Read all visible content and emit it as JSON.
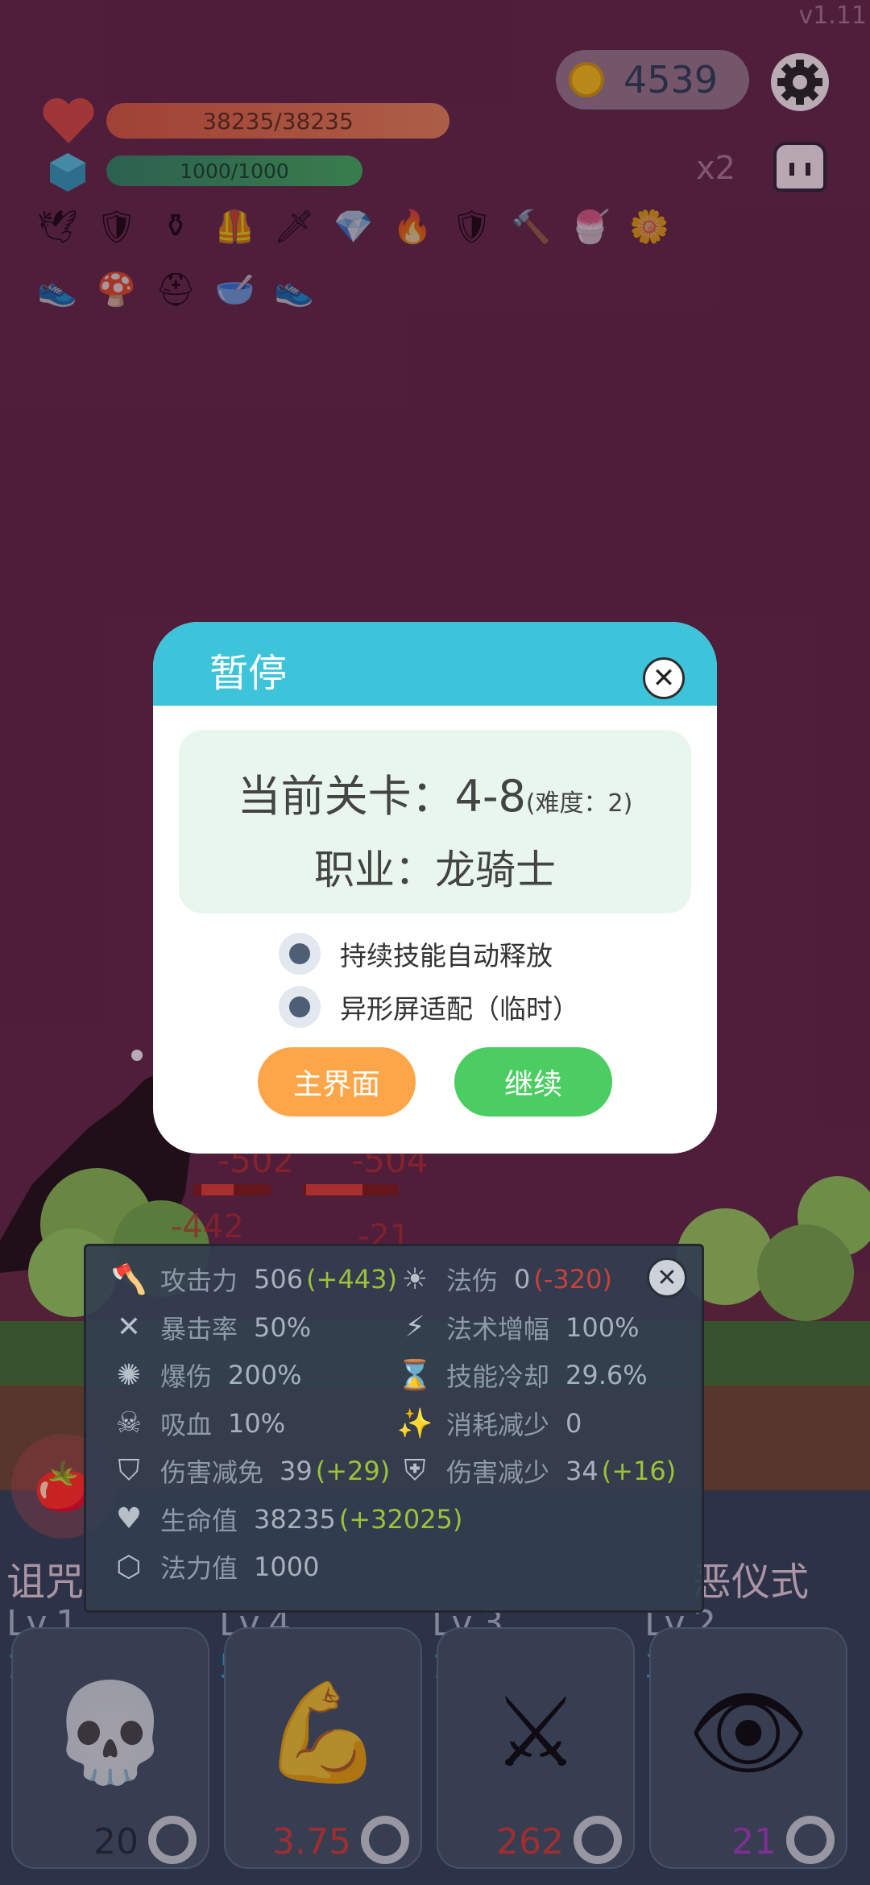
{
  "version": "v1.11",
  "coins": "4539",
  "hud": {
    "hp_text": "38235/38235",
    "hp_fraction": 1.0,
    "mp_text": "1000/1000",
    "mp_fraction": 1.0,
    "speed_multiplier": "x2"
  },
  "inventory": [
    {
      "icon": "bird-icon",
      "glyph": "🕊"
    },
    {
      "icon": "shield-icon",
      "glyph": "🛡"
    },
    {
      "icon": "cauldron-icon",
      "glyph": "⚱"
    },
    {
      "icon": "armor-icon",
      "glyph": "🦺"
    },
    {
      "icon": "sword-icon",
      "glyph": "🗡"
    },
    {
      "icon": "diamond-icon",
      "glyph": "💎"
    },
    {
      "icon": "torch-icon",
      "glyph": "🔥"
    },
    {
      "icon": "shield-icon",
      "glyph": "🛡"
    },
    {
      "icon": "mace-icon",
      "glyph": "🔨"
    },
    {
      "icon": "ice-cream-icon",
      "glyph": "🍧"
    },
    {
      "icon": "flower-icon",
      "glyph": "🌼"
    },
    {
      "icon": "boots-icon",
      "glyph": "👟"
    },
    {
      "icon": "mushroom-icon",
      "glyph": "🍄"
    },
    {
      "icon": "helmet-icon",
      "glyph": "⛑"
    },
    {
      "icon": "mortar-icon",
      "glyph": "🥣"
    },
    {
      "icon": "boots-icon",
      "glyph": "👟"
    }
  ],
  "pause_dialog": {
    "title": "暂停",
    "stage_label": "当前关卡：4-8",
    "difficulty": "(难度：2)",
    "job": "职业：龙骑士",
    "options": [
      {
        "label": "持续技能自动释放",
        "checked": true
      },
      {
        "label": "异形屏适配（临时）",
        "checked": true
      }
    ],
    "main_menu_button": "主界面",
    "continue_button": "继续"
  },
  "floating_damage": [
    "-502",
    "-504",
    "-442",
    "-21"
  ],
  "stats": [
    {
      "icon": "axe-icon",
      "label": "攻击力",
      "value": "506",
      "bonus": "(+443)",
      "bonus_type": "pos"
    },
    {
      "icon": "sun-icon",
      "label": "法伤",
      "value": "0",
      "bonus": "(-320)",
      "bonus_type": "neg"
    },
    {
      "icon": "crit-icon",
      "label": "暴击率",
      "value": "50%"
    },
    {
      "icon": "lightning-icon",
      "label": "法术增幅",
      "value": "100%"
    },
    {
      "icon": "burst-icon",
      "label": "爆伤",
      "value": "200%"
    },
    {
      "icon": "hourglass-icon",
      "label": "技能冷却",
      "value": "29.6%"
    },
    {
      "icon": "vampire-icon",
      "label": "吸血",
      "value": "10%"
    },
    {
      "icon": "wand-icon",
      "label": "消耗减少",
      "value": "0"
    },
    {
      "icon": "shield-icon",
      "label": "伤害减免",
      "value": "39",
      "bonus": "(+29)",
      "bonus_type": "pos"
    },
    {
      "icon": "guard-icon",
      "label": "伤害减少",
      "value": "34",
      "bonus": "(+16)",
      "bonus_type": "pos"
    },
    {
      "icon": "heart-icon",
      "label": "生命值",
      "value": "38235",
      "bonus": "(+32025)",
      "bonus_type": "pos"
    },
    {
      "icon": "hexagon-icon",
      "label": "法力值",
      "value": "1000"
    }
  ],
  "skills": [
    {
      "title": "诅咒",
      "level": "Lv.1",
      "cost": "10",
      "icon": "skull-icon",
      "glyph": "💀",
      "count": "20",
      "count_color": "#1e2a38"
    },
    {
      "title": "",
      "level": "Lv.4",
      "cost": "5",
      "icon": "muscle-icon",
      "glyph": "💪",
      "count": "3.75",
      "count_color": "#c93a36"
    },
    {
      "title": "",
      "level": "Lv.3",
      "cost": "10",
      "icon": "crossed-swords-icon",
      "glyph": "⚔",
      "count": "262",
      "count_color": "#c93a36"
    },
    {
      "title": "恶仪式",
      "level": "Lv.2",
      "cost": "30",
      "icon": "eye-icon",
      "glyph": "👁",
      "count": "21",
      "count_color": "#9b3bb8"
    }
  ]
}
